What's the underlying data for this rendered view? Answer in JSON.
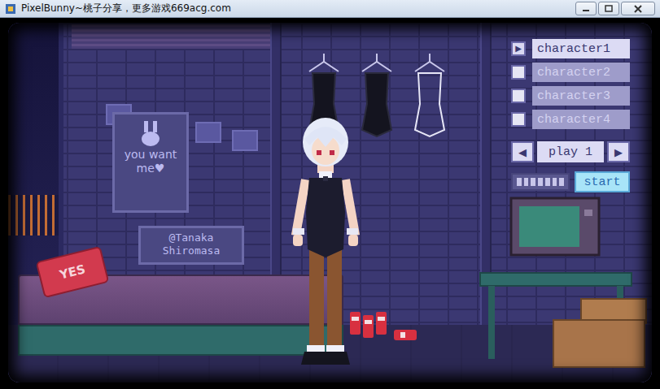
{
  "window": {
    "title": "PixelBunny~桃子分享，更多游戏669acg.com"
  },
  "menu": {
    "marker": "▶",
    "characters": [
      {
        "label": "character1",
        "selected": true
      },
      {
        "label": "character2",
        "selected": false
      },
      {
        "label": "character3",
        "selected": false
      },
      {
        "label": "character4",
        "selected": false
      }
    ],
    "play": {
      "prev": "◀",
      "label": "play 1",
      "next": "▶"
    },
    "gauge": {
      "level": 1
    },
    "start": "start"
  },
  "scene": {
    "poster": [
      "you want",
      "me♥"
    ],
    "credit": [
      "@Tanaka",
      "Shiromasa"
    ],
    "pillow": "YES"
  }
}
